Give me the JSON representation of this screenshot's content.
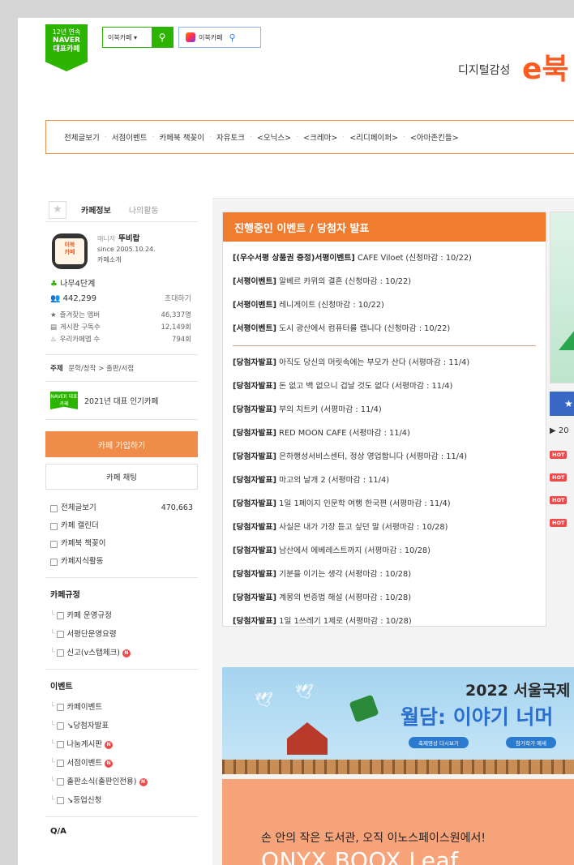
{
  "header": {
    "badge_line1": "12년 연속",
    "badge_line2": "NAVER",
    "badge_line3": "대표카페",
    "search_select": "이북카페 ▾",
    "search_btn_icon": "search-icon",
    "search2_label": "이북카페",
    "logo_sub": "디지털감성",
    "logo_mark": "e북"
  },
  "menubar": [
    "전체글보기",
    "서점이벤트",
    "카페북 책꽂이",
    "자유토크",
    "<오닉스>",
    "<크레마>",
    "<리디페이퍼>",
    "<아마존킨들>"
  ],
  "sidebar": {
    "tab_cafe_info": "카페정보",
    "tab_my_activity": "나의활동",
    "avatar_text": "이북\n카페",
    "manager_label": "매니저",
    "manager_name": "뚜비랍",
    "since": "since 2005.10.24.",
    "cafe_intro": "카페소개",
    "level": "나무4단계",
    "members": "442,299",
    "invite": "초대하기",
    "stats": [
      {
        "label": "즐겨찾는 멤버",
        "value": "46,337명"
      },
      {
        "label": "게시판 구독수",
        "value": "12,149회"
      },
      {
        "label": "우리카페앱 수",
        "value": "794회"
      }
    ],
    "topic_label": "주제",
    "topic_value": "문학/창작 > 출판/서점",
    "popular_badge": "NAVER 대표카페",
    "popular_text": "2021년 대표 인기카페",
    "join_button": "카페 가입하기",
    "chat_button": "카페 채팅",
    "menu": [
      {
        "label": "전체글보기",
        "count": "470,663"
      },
      {
        "label": "카페 캘린더",
        "count": ""
      },
      {
        "label": "카페북 책꽂이",
        "count": ""
      },
      {
        "label": "카페지식활동",
        "count": ""
      }
    ],
    "rules_title": "카페규정",
    "rules": [
      "카페 운영규정",
      "서평단운영요령",
      "신고(v스탭체크)"
    ],
    "events_title": "이벤트",
    "events": [
      "카페이벤트",
      "↘당첨자발표",
      "나눔게시판",
      "서점이벤트",
      "출판소식(출판인전용)",
      "↘등업신청"
    ],
    "qa_title": "Q/A"
  },
  "events_box": {
    "title": "진행중인 이벤트 / 당첨자 발표",
    "items": [
      {
        "tag": "[(우수서평 상품권 증정)서평이벤트]",
        "text": " CAFE Viloet (신청마감 : 10/22)"
      },
      {
        "tag": "[서평이벤트]",
        "text": " 알베르 카뮈의 결혼 (신청마감 : 10/22)"
      },
      {
        "tag": "[서평이벤트]",
        "text": " 레니게이트 (신청마감 : 10/22)"
      },
      {
        "tag": "[서평이벤트]",
        "text": " 도시 광산에서 컴퓨터를 캡니다 (신청마감 : 10/22)"
      }
    ],
    "winners": [
      {
        "tag": "[당첨자발표]",
        "text": " 아직도 당신의 머릿속에는 부모가 산다 (서평마감 : 11/4)"
      },
      {
        "tag": "[당첨자발표]",
        "text": " 돈 없고 백 없으니 겁날 것도 없다 (서평마감 : 11/4)"
      },
      {
        "tag": "[당첨자발표]",
        "text": " 부의 치트키 (서평마감 : 11/4)"
      },
      {
        "tag": "[당첨자발표]",
        "text": " RED MOON CAFE (서평마감 : 11/4)"
      },
      {
        "tag": "[당첨자발표]",
        "text": " 은하행성서비스센터, 정상 영업합니다 (서평마감 : 11/4)"
      },
      {
        "tag": "[당첨자발표]",
        "text": " 마고의 날개 2 (서평마감 : 11/4)"
      },
      {
        "tag": "[당첨자발표]",
        "text": " 1일 1페이지 인문학 여행 한국편 (서평마감 : 11/4)"
      },
      {
        "tag": "[당첨자발표]",
        "text": " 사실은 내가 가장 듣고 싶던 말 (서평마감 : 10/28)"
      },
      {
        "tag": "[당첨자발표]",
        "text": " 남산에서 에베레스트까지 (서평마감 : 10/28)"
      },
      {
        "tag": "[당첨자발표]",
        "text": " 기분을 이기는 생각 (서평마감 : 10/28)"
      },
      {
        "tag": "[당첨자발표]",
        "text": " 계몽의 변증법 해설 (서평마감 : 10/28)"
      },
      {
        "tag": "[당첨자발표]",
        "text": " 1일 1쓰레기 1제로 (서평마감 : 10/28)"
      }
    ]
  },
  "right_col": {
    "bar_icon": "★",
    "date_prefix": "▶ 20",
    "hot_label": "HOT"
  },
  "banner1": {
    "year_title": "2022 서울국제",
    "big_title": "월담: 이야기 너머",
    "pill1": "축제영상 다시보기",
    "pill2": "참가작가 예세"
  },
  "banner2": {
    "line1": "손 안의 작은 도서관, 오직 이노스페이스원에서!",
    "line2": "ONYX BOOX Leaf"
  },
  "colors": {
    "accent": "#f07d2f",
    "naver_green": "#2db400",
    "hot_red": "#f04a4a"
  }
}
